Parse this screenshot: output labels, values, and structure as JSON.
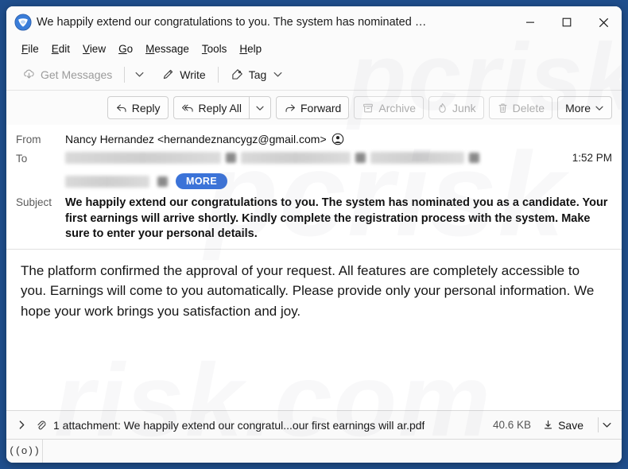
{
  "window": {
    "title": "We happily extend our congratulations to you. The system has nominated …",
    "app_icon": "thunderbird-logo-icon",
    "minimize_label": "Minimize",
    "maximize_label": "Maximize",
    "close_label": "Close",
    "border_color": "#1f4e8c",
    "chrome_color": "#fbfbfb"
  },
  "menubar": {
    "items": [
      {
        "label": "File",
        "accesskey": "F"
      },
      {
        "label": "Edit",
        "accesskey": "E"
      },
      {
        "label": "View",
        "accesskey": "V"
      },
      {
        "label": "Go",
        "accesskey": "G"
      },
      {
        "label": "Message",
        "accesskey": "M"
      },
      {
        "label": "Tools",
        "accesskey": "T"
      },
      {
        "label": "Help",
        "accesskey": "H"
      }
    ]
  },
  "toolbar": {
    "get_messages_label": "Get Messages",
    "get_messages_icon": "cloud-download-icon",
    "get_messages_disabled": true,
    "get_messages_chevron_icon": "chevron-down-icon",
    "write_label": "Write",
    "write_icon": "pencil-icon",
    "tag_label": "Tag",
    "tag_icon": "tag-icon",
    "tag_chevron_icon": "chevron-down-icon"
  },
  "message_actions": {
    "reply_label": "Reply",
    "reply_icon": "reply-arrow-icon",
    "reply_all_label": "Reply All",
    "reply_all_icon": "reply-all-arrow-icon",
    "reply_all_chevron_icon": "chevron-down-icon",
    "forward_label": "Forward",
    "forward_icon": "forward-arrow-icon",
    "archive_label": "Archive",
    "archive_icon": "archive-box-icon",
    "archive_disabled": true,
    "junk_label": "Junk",
    "junk_icon": "flame-icon",
    "junk_disabled": true,
    "delete_label": "Delete",
    "delete_icon": "trash-icon",
    "delete_disabled": true,
    "more_label": "More",
    "more_chevron_icon": "chevron-down-icon"
  },
  "headers": {
    "from_label": "From",
    "from_value": "Nancy Hernandez <hernandeznancygz@gmail.com>",
    "from_contact_icon": "contact-avatar-icon",
    "to_label": "To",
    "to_redacted": true,
    "to_more_label": "MORE",
    "more_pill_color": "#3b73d8",
    "time": "1:52 PM",
    "subject_label": "Subject",
    "subject_value": "We happily extend our congratulations to you. The system has nominated you as a candidate. Your first earnings will arrive shortly. Kindly complete the registration process with the system. Make sure to enter your personal details."
  },
  "body": {
    "text": "The platform confirmed the approval of your request. All features are completely accessible to you. Earnings will come to you automatically. Please provide only your personal information. We hope your work brings you satisfaction and joy."
  },
  "attachment": {
    "expand_icon": "chevron-right-icon",
    "paperclip_icon": "paperclip-icon",
    "summary": "1 attachment: We happily extend our congratul...our first earnings will ar.pdf",
    "size": "40.6 KB",
    "save_label": "Save",
    "save_icon": "download-icon",
    "chevron_icon": "chevron-down-icon"
  },
  "statusbar": {
    "icon": "broadcast-icon",
    "icon_glyph": "((o))"
  },
  "watermark": {
    "line1": "pcrisk",
    "line2": "risk.com",
    "line3": "pcrisk"
  }
}
